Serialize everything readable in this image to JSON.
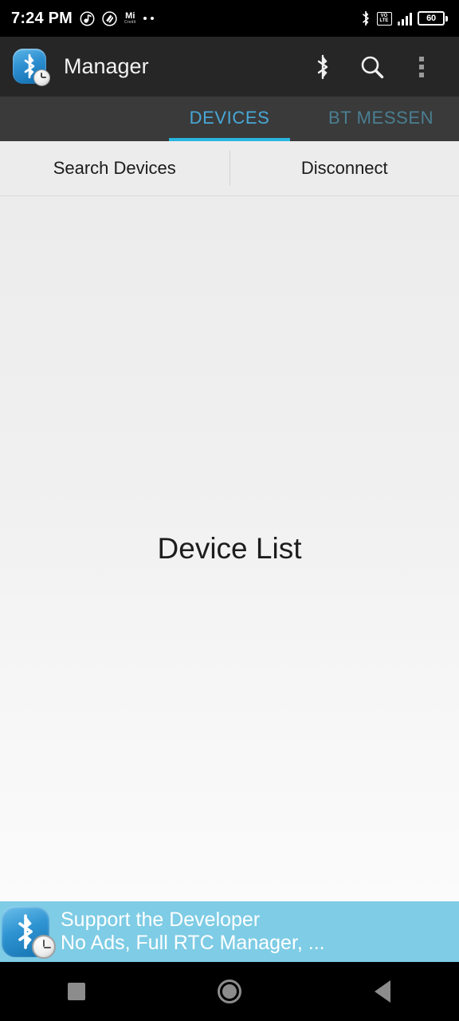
{
  "status_bar": {
    "time": "7:24 PM",
    "left_icons": [
      "music-note-icon",
      "snapdeal-logo-icon",
      "mi-credit-icon",
      "more-notifications-dots-icon"
    ],
    "mi_credit_label": "Mi",
    "mi_credit_sub": "Credit",
    "right_icons": [
      "bluetooth-icon",
      "volte-icon",
      "signal-bars-icon",
      "battery-icon"
    ],
    "volte_top": "VO",
    "volte_bottom": "LTE",
    "battery_level": "60"
  },
  "action_bar": {
    "app_icon": "bluetooth-clock-app-icon",
    "title": "Manager",
    "actions": [
      {
        "name": "bluetooth-toggle-icon"
      },
      {
        "name": "search-icon"
      },
      {
        "name": "overflow-menu-icon"
      }
    ]
  },
  "tabs": {
    "active_index": 0,
    "items": [
      {
        "label": "DEVICES",
        "active": true
      },
      {
        "label": "BT MESSEN",
        "active": false
      }
    ],
    "indicator_color": "#29b6e0",
    "active_color": "#48a8d8",
    "inactive_color": "#4a7f92"
  },
  "toolbar": {
    "search_devices_label": "Search Devices",
    "disconnect_label": "Disconnect"
  },
  "content": {
    "placeholder": "Device List"
  },
  "ad_banner": {
    "icon": "bluetooth-clock-app-icon",
    "line1": "Support the Developer",
    "line2": "No Ads, Full RTC Manager, ...",
    "background_color": "#7ecce5"
  },
  "nav_bar": {
    "buttons": [
      {
        "name": "recents-button"
      },
      {
        "name": "home-button"
      },
      {
        "name": "back-button"
      }
    ]
  }
}
